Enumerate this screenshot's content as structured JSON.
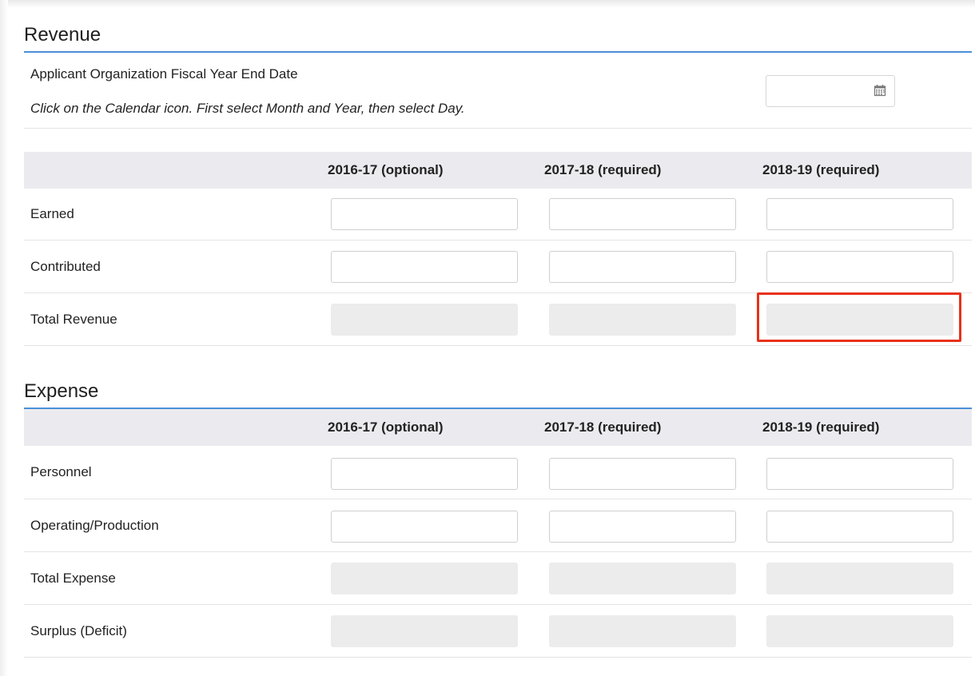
{
  "revenue": {
    "title": "Revenue",
    "fiscal_label": "Applicant Organization Fiscal Year End Date",
    "fiscal_hint": "Click on the Calendar icon. First select Month and Year, then select Day.",
    "fiscal_value": "",
    "columns": [
      "2016-17 (optional)",
      "2017-18 (required)",
      "2018-19 (required)"
    ],
    "rows": [
      {
        "label": "Earned",
        "values": [
          "",
          "",
          ""
        ],
        "readonly": false
      },
      {
        "label": "Contributed",
        "values": [
          "",
          "",
          ""
        ],
        "readonly": false
      },
      {
        "label": "Total Revenue",
        "values": [
          "",
          "",
          ""
        ],
        "readonly": true
      }
    ]
  },
  "expense": {
    "title": "Expense",
    "columns": [
      "2016-17 (optional)",
      "2017-18 (required)",
      "2018-19 (required)"
    ],
    "rows": [
      {
        "label": "Personnel",
        "values": [
          "",
          "",
          ""
        ],
        "readonly": false
      },
      {
        "label": "Operating/Production",
        "values": [
          "",
          "",
          ""
        ],
        "readonly": false
      },
      {
        "label": "Total Expense",
        "values": [
          "",
          "",
          ""
        ],
        "readonly": true
      },
      {
        "label": "Surplus (Deficit)",
        "values": [
          "",
          "",
          ""
        ],
        "readonly": true
      }
    ]
  },
  "icons": {
    "calendar": "calendar-icon"
  },
  "colors": {
    "accent_rule": "#4a90d9",
    "highlight_box": "#e8311a",
    "header_band": "#ebebef",
    "readonly_field": "#ececec"
  }
}
